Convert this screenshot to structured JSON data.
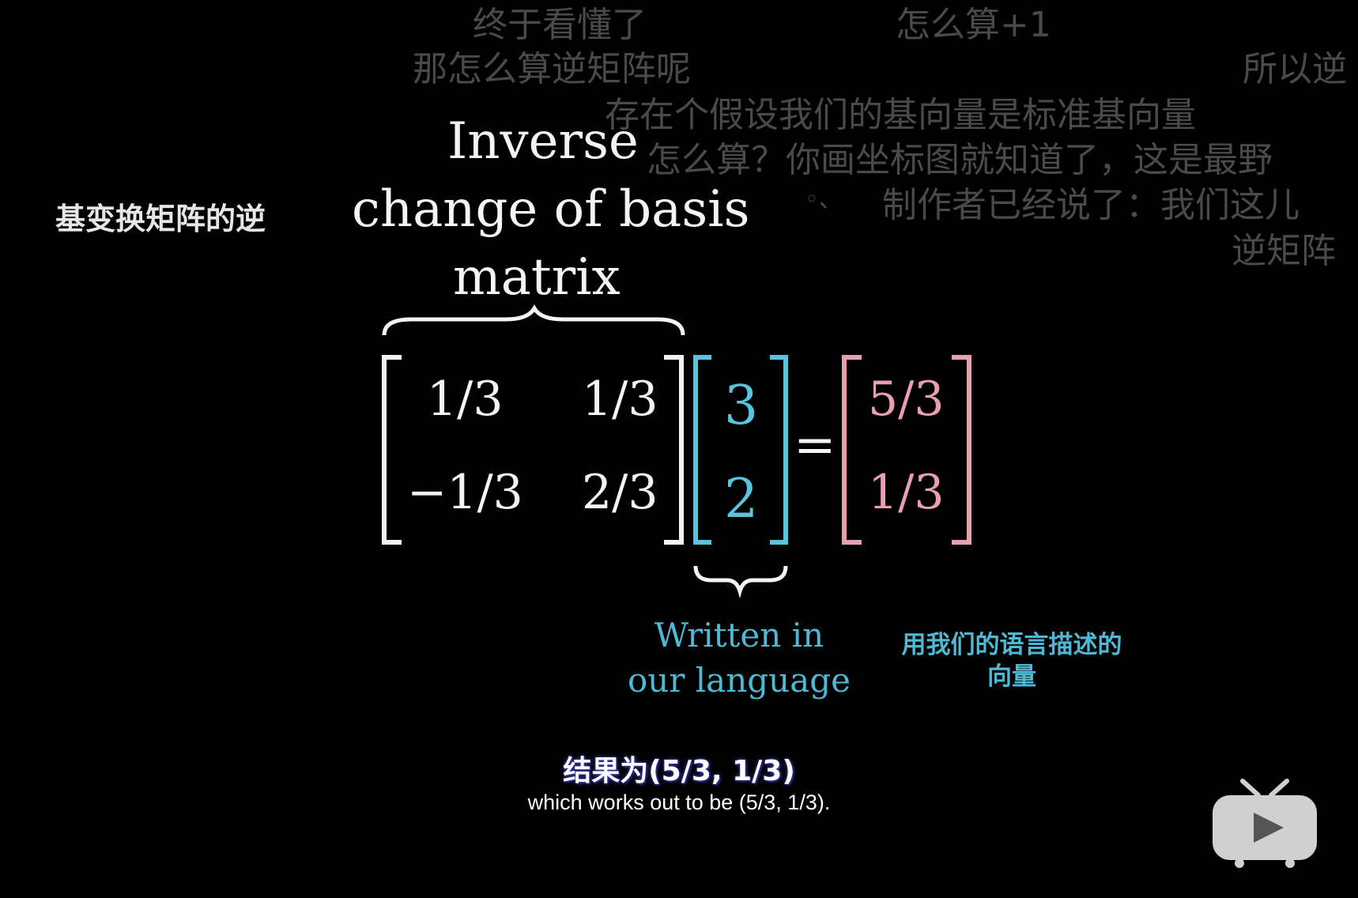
{
  "danmaku": [
    "终于看懂了",
    "怎么算+1",
    "那怎么算逆矩阵呢",
    "所以逆",
    "存在个假设我们的基向量是标准基向量",
    "怎么算？你画坐标图就知道了，这是最野",
    "◦、",
    "制作者已经说了：我们这儿",
    "逆矩阵"
  ],
  "left_label": "基变换矩阵的逆",
  "heading": {
    "line1": "Inverse",
    "line2": "change of basis",
    "line3": "matrix"
  },
  "matrix": {
    "r1c1": "1/3",
    "r1c2": "1/3",
    "r2c1": "−1/3",
    "r2c2": "2/3"
  },
  "vector": {
    "v1": "3",
    "v2": "2"
  },
  "equals": "=",
  "result": {
    "r1": "5/3",
    "r2": "1/3"
  },
  "written": {
    "line1": "Written in",
    "line2": "our language"
  },
  "cyan_label": {
    "line1": "用我们的语言描述的",
    "line2": "向量"
  },
  "subtitle_cn": "结果为(5/3, 1/3)",
  "subtitle_en": "which works out to be (5/3, 1/3).",
  "colors": {
    "white": "#f4f4f4",
    "cyan": "#58c4dd",
    "pink": "#e8a0b0",
    "danmaku": "#4a4a4a"
  },
  "icon": "bilibili-tv-play-icon"
}
